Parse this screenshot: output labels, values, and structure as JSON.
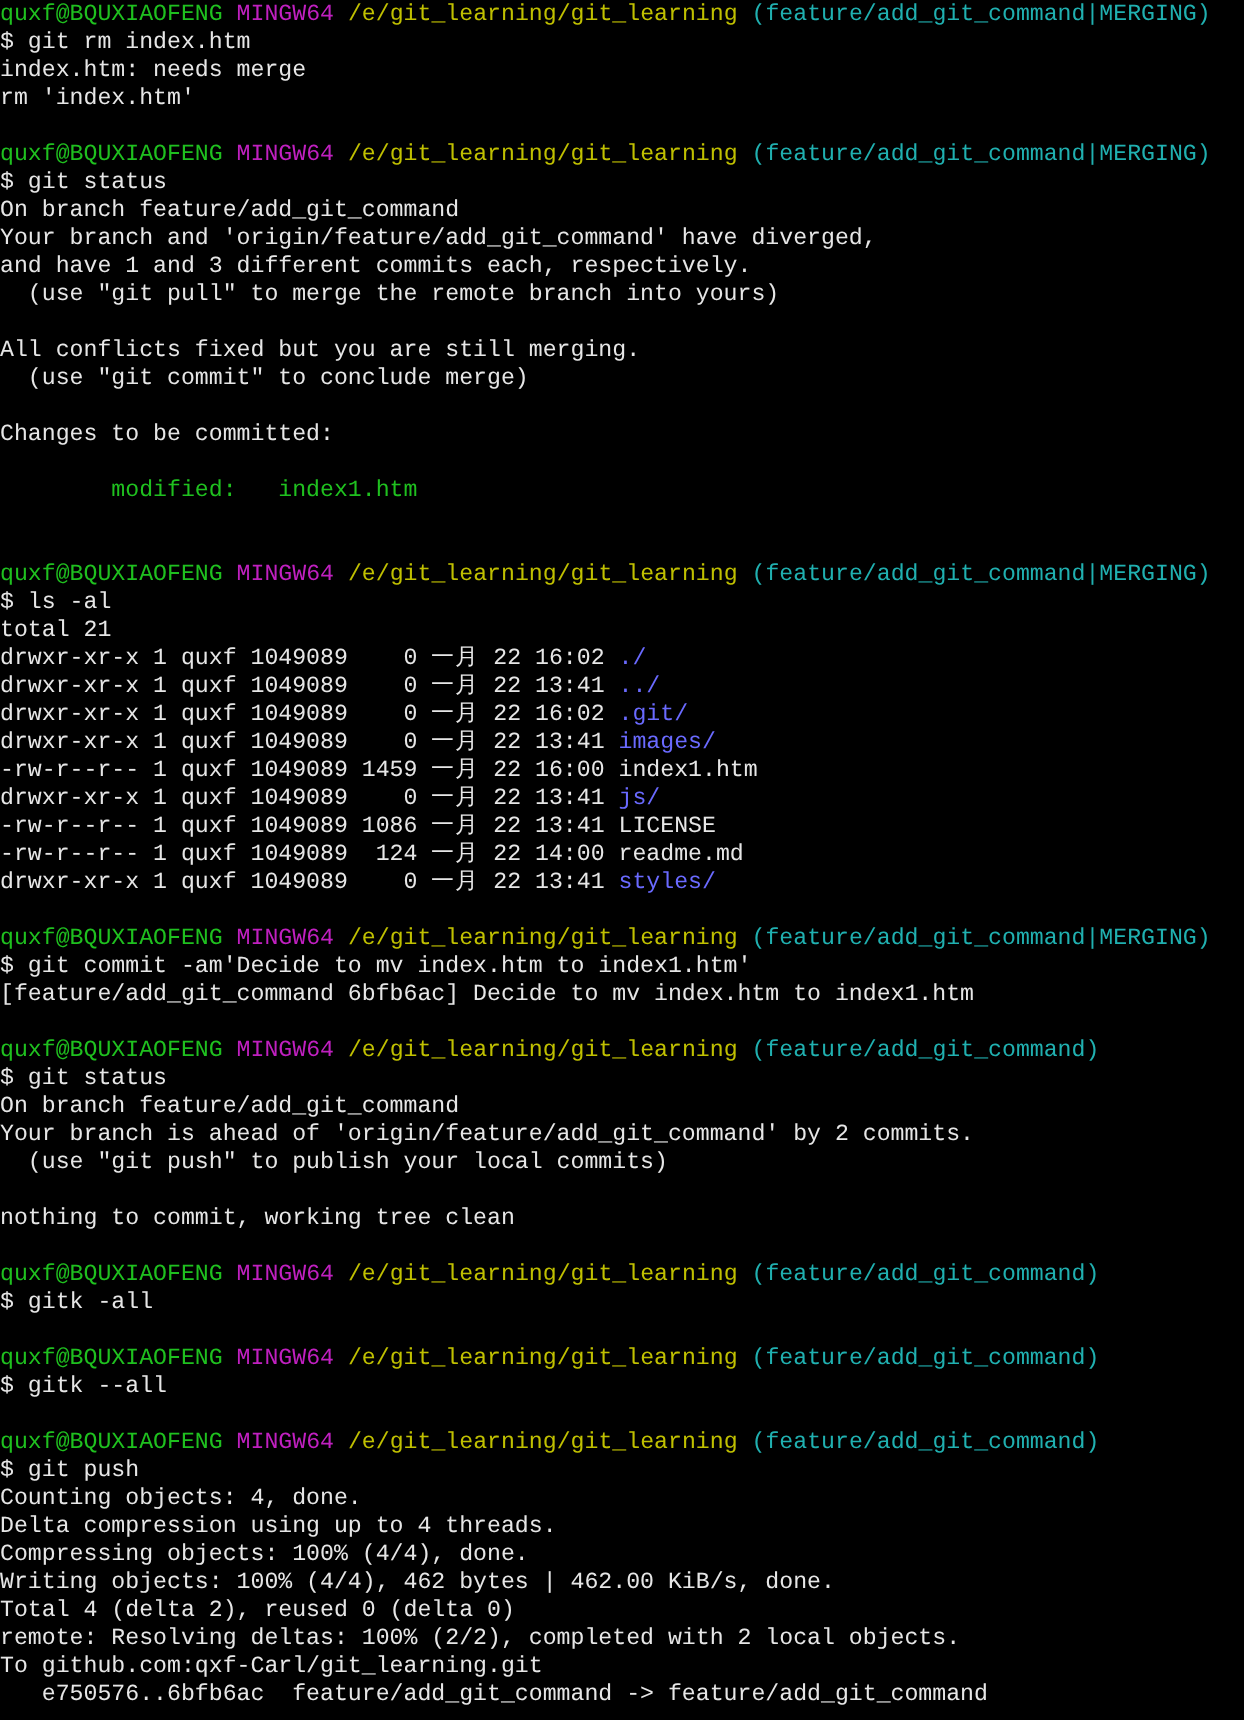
{
  "blocks": [
    {
      "prompt": {
        "user": "quxf@BQUXIAOFENG",
        "system": "MINGW64",
        "path": "/e/git_learning/git_learning",
        "branch": "(feature/add_git_command|MERGING)"
      },
      "command": "$ git rm index.htm",
      "output": [
        {
          "kind": "text",
          "spans": [
            {
              "text": "index.htm: needs merge",
              "kind": "plain"
            }
          ]
        },
        {
          "kind": "text",
          "spans": [
            {
              "text": "rm 'index.htm'",
              "kind": "plain"
            }
          ]
        }
      ]
    },
    {
      "prompt": {
        "user": "quxf@BQUXIAOFENG",
        "system": "MINGW64",
        "path": "/e/git_learning/git_learning",
        "branch": "(feature/add_git_command|MERGING)"
      },
      "command": "$ git status",
      "output": [
        {
          "kind": "text",
          "spans": [
            {
              "text": "On branch feature/add_git_command",
              "kind": "plain"
            }
          ]
        },
        {
          "kind": "text",
          "spans": [
            {
              "text": "Your branch and 'origin/feature/add_git_command' have diverged,",
              "kind": "plain"
            }
          ]
        },
        {
          "kind": "text",
          "spans": [
            {
              "text": "and have 1 and 3 different commits each, respectively.",
              "kind": "plain"
            }
          ]
        },
        {
          "kind": "text",
          "spans": [
            {
              "text": "  (use \"git pull\" to merge the remote branch into yours)",
              "kind": "plain"
            }
          ]
        },
        {
          "kind": "blank"
        },
        {
          "kind": "text",
          "spans": [
            {
              "text": "All conflicts fixed but you are still merging.",
              "kind": "plain"
            }
          ]
        },
        {
          "kind": "text",
          "spans": [
            {
              "text": "  (use \"git commit\" to conclude merge)",
              "kind": "plain"
            }
          ]
        },
        {
          "kind": "blank"
        },
        {
          "kind": "text",
          "spans": [
            {
              "text": "Changes to be committed:",
              "kind": "plain"
            }
          ]
        },
        {
          "kind": "blank"
        },
        {
          "kind": "text",
          "spans": [
            {
              "text": "        modified:   index1.htm",
              "kind": "staged"
            }
          ]
        },
        {
          "kind": "blank"
        }
      ]
    },
    {
      "prompt": {
        "user": "quxf@BQUXIAOFENG",
        "system": "MINGW64",
        "path": "/e/git_learning/git_learning",
        "branch": "(feature/add_git_command|MERGING)"
      },
      "command": "$ ls -al",
      "output": [
        {
          "kind": "text",
          "spans": [
            {
              "text": "total 21",
              "kind": "plain"
            }
          ]
        },
        {
          "kind": "text",
          "spans": [
            {
              "text": "drwxr-xr-x 1 quxf 1049089    0 一月 22 16:02 ",
              "kind": "plain"
            },
            {
              "text": "./",
              "kind": "directory"
            }
          ]
        },
        {
          "kind": "text",
          "spans": [
            {
              "text": "drwxr-xr-x 1 quxf 1049089    0 一月 22 13:41 ",
              "kind": "plain"
            },
            {
              "text": "../",
              "kind": "directory"
            }
          ]
        },
        {
          "kind": "text",
          "spans": [
            {
              "text": "drwxr-xr-x 1 quxf 1049089    0 一月 22 16:02 ",
              "kind": "plain"
            },
            {
              "text": ".git/",
              "kind": "directory"
            }
          ]
        },
        {
          "kind": "text",
          "spans": [
            {
              "text": "drwxr-xr-x 1 quxf 1049089    0 一月 22 13:41 ",
              "kind": "plain"
            },
            {
              "text": "images/",
              "kind": "directory"
            }
          ]
        },
        {
          "kind": "text",
          "spans": [
            {
              "text": "-rw-r--r-- 1 quxf 1049089 1459 一月 22 16:00 index1.htm",
              "kind": "plain"
            }
          ]
        },
        {
          "kind": "text",
          "spans": [
            {
              "text": "drwxr-xr-x 1 quxf 1049089    0 一月 22 13:41 ",
              "kind": "plain"
            },
            {
              "text": "js/",
              "kind": "directory"
            }
          ]
        },
        {
          "kind": "text",
          "spans": [
            {
              "text": "-rw-r--r-- 1 quxf 1049089 1086 一月 22 13:41 LICENSE",
              "kind": "plain"
            }
          ]
        },
        {
          "kind": "text",
          "spans": [
            {
              "text": "-rw-r--r-- 1 quxf 1049089  124 一月 22 14:00 readme.md",
              "kind": "plain"
            }
          ]
        },
        {
          "kind": "text",
          "spans": [
            {
              "text": "drwxr-xr-x 1 quxf 1049089    0 一月 22 13:41 ",
              "kind": "plain"
            },
            {
              "text": "styles/",
              "kind": "directory"
            }
          ]
        }
      ]
    },
    {
      "prompt": {
        "user": "quxf@BQUXIAOFENG",
        "system": "MINGW64",
        "path": "/e/git_learning/git_learning",
        "branch": "(feature/add_git_command|MERGING)"
      },
      "command": "$ git commit -am'Decide to mv index.htm to index1.htm'",
      "output": [
        {
          "kind": "text",
          "spans": [
            {
              "text": "[feature/add_git_command 6bfb6ac] Decide to mv index.htm to index1.htm",
              "kind": "plain"
            }
          ]
        }
      ]
    },
    {
      "prompt": {
        "user": "quxf@BQUXIAOFENG",
        "system": "MINGW64",
        "path": "/e/git_learning/git_learning",
        "branch": "(feature/add_git_command)"
      },
      "command": "$ git status",
      "output": [
        {
          "kind": "text",
          "spans": [
            {
              "text": "On branch feature/add_git_command",
              "kind": "plain"
            }
          ]
        },
        {
          "kind": "text",
          "spans": [
            {
              "text": "Your branch is ahead of 'origin/feature/add_git_command' by 2 commits.",
              "kind": "plain"
            }
          ]
        },
        {
          "kind": "text",
          "spans": [
            {
              "text": "  (use \"git push\" to publish your local commits)",
              "kind": "plain"
            }
          ]
        },
        {
          "kind": "blank"
        },
        {
          "kind": "text",
          "spans": [
            {
              "text": "nothing to commit, working tree clean",
              "kind": "plain"
            }
          ]
        }
      ]
    },
    {
      "prompt": {
        "user": "quxf@BQUXIAOFENG",
        "system": "MINGW64",
        "path": "/e/git_learning/git_learning",
        "branch": "(feature/add_git_command)"
      },
      "command": "$ gitk -all"
    },
    {
      "prompt": {
        "user": "quxf@BQUXIAOFENG",
        "system": "MINGW64",
        "path": "/e/git_learning/git_learning",
        "branch": "(feature/add_git_command)"
      },
      "command": "$ gitk --all"
    },
    {
      "prompt": {
        "user": "quxf@BQUXIAOFENG",
        "system": "MINGW64",
        "path": "/e/git_learning/git_learning",
        "branch": "(feature/add_git_command)"
      },
      "command": "$ git push",
      "output": [
        {
          "kind": "text",
          "spans": [
            {
              "text": "Counting objects: 4, done.",
              "kind": "plain"
            }
          ]
        },
        {
          "kind": "text",
          "spans": [
            {
              "text": "Delta compression using up to 4 threads.",
              "kind": "plain"
            }
          ]
        },
        {
          "kind": "text",
          "spans": [
            {
              "text": "Compressing objects: 100% (4/4), done.",
              "kind": "plain"
            }
          ]
        },
        {
          "kind": "text",
          "spans": [
            {
              "text": "Writing objects: 100% (4/4), 462 bytes | 462.00 KiB/s, done.",
              "kind": "plain"
            }
          ]
        },
        {
          "kind": "text",
          "spans": [
            {
              "text": "Total 4 (delta 2), reused 0 (delta 0)",
              "kind": "plain"
            }
          ]
        },
        {
          "kind": "text",
          "spans": [
            {
              "text": "remote: Resolving deltas: 100% (2/2), completed with 2 local objects.",
              "kind": "plain"
            }
          ]
        },
        {
          "kind": "text",
          "spans": [
            {
              "text": "To github.com:qxf-Carl/git_learning.git",
              "kind": "plain"
            }
          ]
        },
        {
          "kind": "text",
          "spans": [
            {
              "text": "   e750576..6bfb6ac  feature/add_git_command -> feature/add_git_command",
              "kind": "plain"
            }
          ]
        }
      ]
    }
  ]
}
